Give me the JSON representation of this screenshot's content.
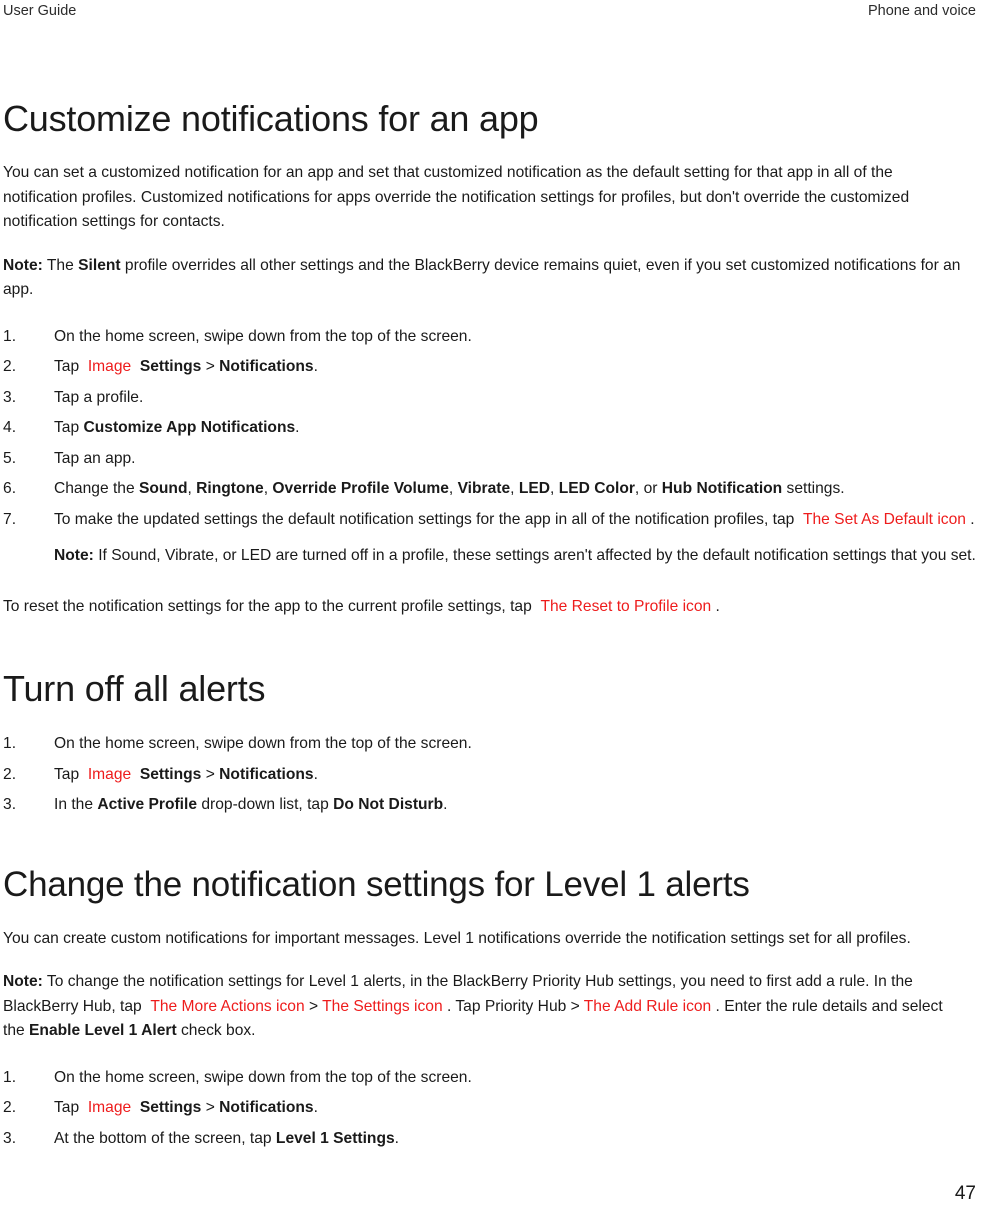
{
  "header": {
    "left": "User Guide",
    "right": "Phone and voice"
  },
  "colors": {
    "icon_placeholder_red": "#ee1c1c",
    "body_text": "#1a1a1a",
    "page_background": "#ffffff"
  },
  "footer": {
    "page_number": "47"
  },
  "sections": [
    {
      "title": "Customize notifications for an app",
      "intro": "You can set a customized notification for an app and set that customized notification as the default setting for that app in all of the notification profiles. Customized notifications for apps override the notification settings for profiles, but don't override the customized notification settings for contacts.",
      "note_label": "Note:",
      "note_before": " The ",
      "note_bold": "Silent",
      "note_after": " profile overrides all other settings and the BlackBerry device remains quiet, even if you set customized notifications for an app.",
      "steps": {
        "s1": "On the home screen, swipe down from the top of the screen.",
        "s2_tap": "Tap",
        "s2_image": "Image",
        "s2_settings": "Settings",
        "s2_sep": ">",
        "s2_notifications": "Notifications",
        "s2_period": ".",
        "s3": "Tap a profile.",
        "s4_tap": "Tap ",
        "s4_bold": "Customize App Notifications",
        "s4_period": ".",
        "s5": "Tap an app.",
        "s6_lead": "Change the ",
        "s6_terms": [
          "Sound",
          "Ringtone",
          "Override Profile Volume",
          "Vibrate",
          "LED",
          "LED Color",
          "Hub Notification"
        ],
        "s6_or": ", or ",
        "s6_tail": " settings.",
        "s7_lead": "To make the updated settings the default notification settings for the app in all of the notification profiles, tap ",
        "s7_icon": "The Set As Default icon",
        "s7_tail": " .",
        "s7_note_label": "Note:",
        "s7_note_text": " If Sound, Vibrate, or LED are turned off in a profile, these settings aren't affected by the default notification settings that you set."
      },
      "reset_lead": "To reset the notification settings for the app to the current profile settings, tap ",
      "reset_icon": "The Reset to Profile icon",
      "reset_tail": " ."
    },
    {
      "title": "Turn off all alerts",
      "steps": {
        "s1": "On the home screen, swipe down from the top of the screen.",
        "s2_tap": "Tap",
        "s2_image": "Image",
        "s2_settings": "Settings",
        "s2_sep": ">",
        "s2_notifications": "Notifications",
        "s2_period": ".",
        "s3_lead": "In the ",
        "s3_bold1": "Active Profile",
        "s3_mid": " drop-down list, tap ",
        "s3_bold2": "Do Not Disturb",
        "s3_period": "."
      }
    },
    {
      "title": "Change the notification settings for Level 1 alerts",
      "intro": "You can create custom notifications for important messages. Level 1 notifications override the notification settings set for all profiles.",
      "note_label": "Note:",
      "note_a": " To change the notification settings for Level 1 alerts, in the BlackBerry Priority Hub settings, you need to first add a rule. In the BlackBerry Hub, tap ",
      "note_icon1": "The More Actions icon",
      "note_sep1": " > ",
      "note_icon2": "The Settings icon",
      "note_b": " . Tap Priority Hub > ",
      "note_icon3": "The Add Rule icon",
      "note_c": " . Enter the rule details and select the ",
      "note_bold": "Enable Level 1 Alert",
      "note_d": " check box.",
      "steps": {
        "s1": "On the home screen, swipe down from the top of the screen.",
        "s2_tap": "Tap",
        "s2_image": "Image",
        "s2_settings": "Settings",
        "s2_sep": ">",
        "s2_notifications": "Notifications",
        "s2_period": ".",
        "s3_lead": "At the bottom of the screen, tap ",
        "s3_bold": "Level 1 Settings",
        "s3_period": "."
      }
    }
  ]
}
